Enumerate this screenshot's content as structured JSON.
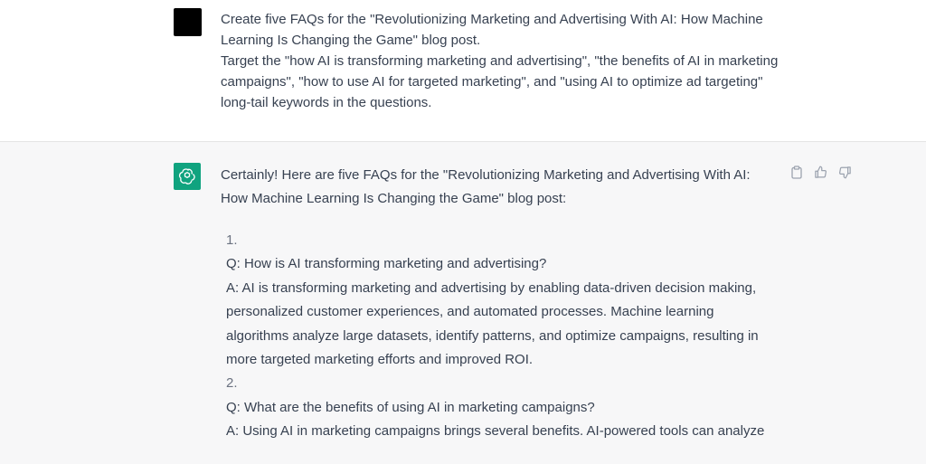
{
  "user_message": {
    "lines": [
      "Create five FAQs for the \"Revolutionizing Marketing and Advertising With AI: How Machine Learning Is Changing the Game\" blog post.",
      "Target the \"how AI is transforming marketing and advertising\", \"the benefits of AI in marketing campaigns\", \"how to use AI for targeted marketing\", and \"using AI to optimize ad targeting\" long-tail keywords in the questions."
    ]
  },
  "assistant_message": {
    "intro": "Certainly! Here are five FAQs for the \"Revolutionizing Marketing and Advertising With AI: How Machine Learning Is Changing the Game\" blog post:",
    "items": [
      {
        "number": "1.",
        "question": "Q: How is AI transforming marketing and advertising?",
        "answer": "A: AI is transforming marketing and advertising by enabling data-driven decision making, personalized customer experiences, and automated processes. Machine learning algorithms analyze large datasets, identify patterns, and optimize campaigns, resulting in more targeted marketing efforts and improved ROI."
      },
      {
        "number": "2.",
        "question": "Q: What are the benefits of using AI in marketing campaigns?",
        "answer": "A: Using AI in marketing campaigns brings several benefits. AI-powered tools can analyze"
      }
    ]
  },
  "actions": {
    "copy_icon": "clipboard-icon",
    "like_icon": "thumbs-up-icon",
    "dislike_icon": "thumbs-down-icon"
  },
  "colors": {
    "accent": "#10a37f",
    "assistant_bg": "#f7f7f8",
    "text": "#374151"
  }
}
